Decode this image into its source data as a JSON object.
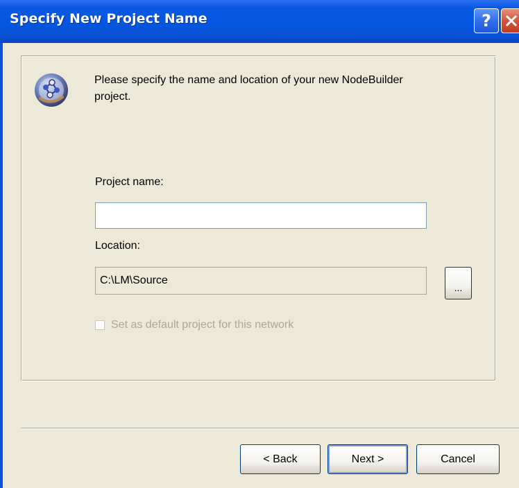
{
  "window": {
    "title": "Specify New Project Name",
    "help_label": "?",
    "close_icon": "close-icon"
  },
  "intro": {
    "icon": "nodebuilder-app-icon",
    "text": "Please specify the name and location of your new NodeBuilder project."
  },
  "project_name": {
    "label": "Project name:",
    "value": ""
  },
  "location": {
    "label": "Location:",
    "value": "C:\\LM\\Source",
    "browse_label": "..."
  },
  "default_checkbox": {
    "label": "Set as default project for this network",
    "checked": false,
    "enabled": false
  },
  "buttons": {
    "back": "< Back",
    "next": "Next >",
    "cancel": "Cancel"
  },
  "colors": {
    "titlebar": "#0456E0",
    "dialog_bg": "#ECE9D8",
    "disabled_text": "#ACA899",
    "close_button": "#D4533A"
  }
}
